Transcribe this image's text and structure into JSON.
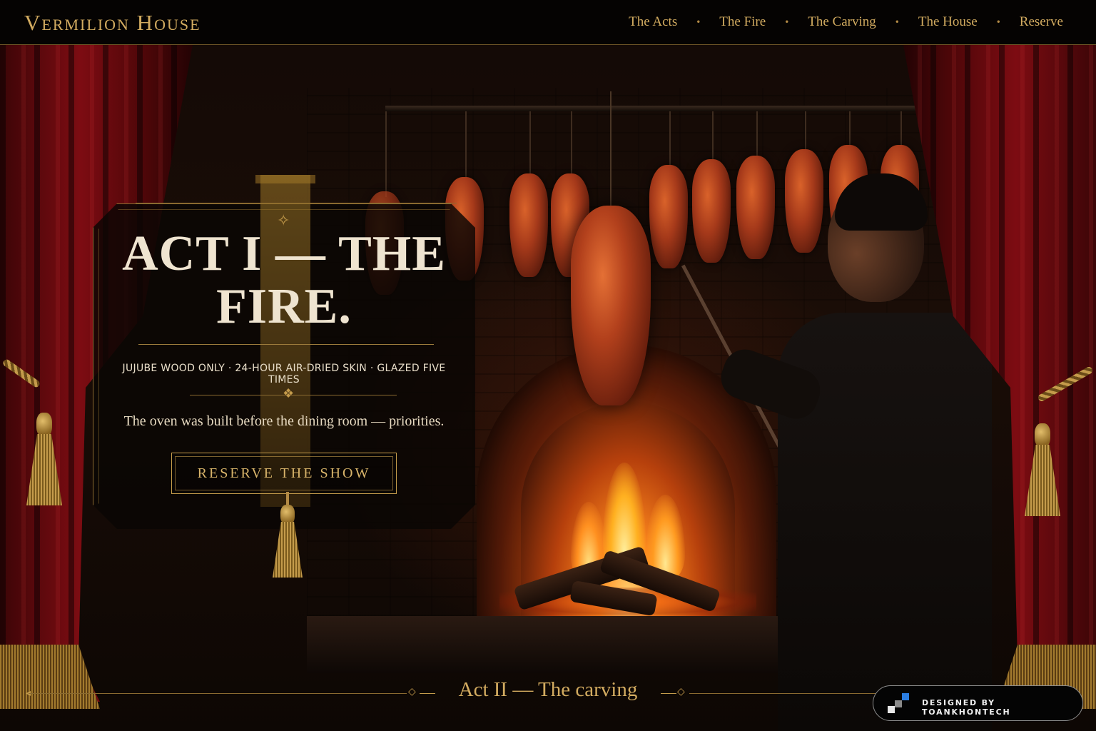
{
  "header": {
    "brand": "Vermilion House",
    "nav": [
      {
        "label": "The Acts"
      },
      {
        "label": "The Fire"
      },
      {
        "label": "The Carving"
      },
      {
        "label": "The House"
      },
      {
        "label": "Reserve"
      }
    ],
    "nav_separator": "•"
  },
  "hero": {
    "title_line1": "ACT I — THE",
    "title_line2": "FIRE.",
    "features": "JUJUBE WOOD ONLY · 24-HOUR AIR-DRIED SKIN · GLAZED FIVE TIMES",
    "tagline": "The oven was built before the dining room — priorities.",
    "cta_label": "RESERVE THE SHOW"
  },
  "act_nav": {
    "next_label": "Act II — The carving"
  },
  "credit": {
    "label": "DESIGNED BY TOANKHONTECH"
  },
  "colors": {
    "accent_gold": "#d2ab60",
    "curtain_red": "#7d0c12",
    "background": "#0b0604",
    "fire_orange": "#ff8a1e"
  },
  "icons": {
    "ornament": "gold-diamond-ornament-icon",
    "tassel": "gold-tassel-icon",
    "credit_logo": "pixel-squares-logo-icon"
  }
}
